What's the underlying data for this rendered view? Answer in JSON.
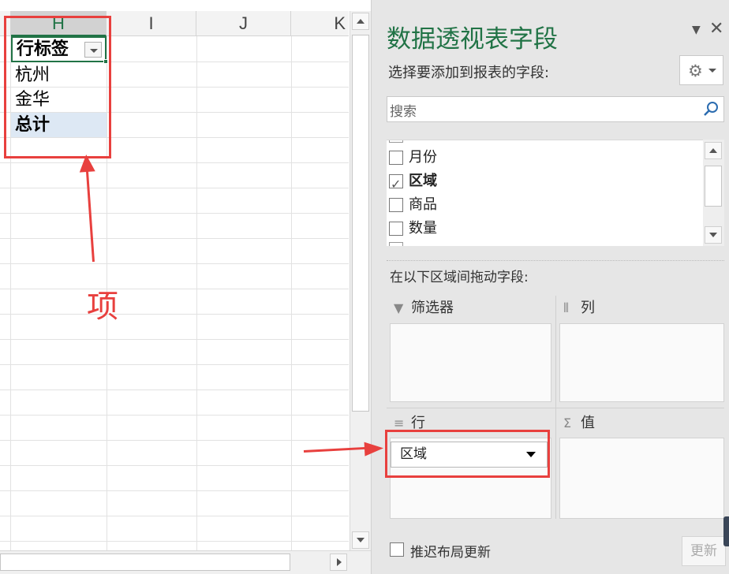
{
  "sheet": {
    "columns": [
      "H",
      "I",
      "J",
      "K"
    ],
    "active_column": "H",
    "pivot": {
      "header": "行标签",
      "rows": [
        "杭州",
        "金华"
      ],
      "total": "总计"
    }
  },
  "annotations": {
    "item_label": "项"
  },
  "panel": {
    "title": "数据透视表字段",
    "subtitle": "选择要添加到报表的字段:",
    "search_placeholder": "搜索",
    "fields": [
      {
        "label": "月份",
        "checked": false
      },
      {
        "label": "区域",
        "checked": true
      },
      {
        "label": "商品",
        "checked": false
      },
      {
        "label": "数量",
        "checked": false
      }
    ],
    "drag_prompt": "在以下区域间拖动字段:",
    "areas": {
      "filters": "筛选器",
      "columns": "列",
      "rows": "行",
      "values": "值"
    },
    "row_field": "区域",
    "defer_label": "推迟布局更新",
    "update_label": "更新"
  },
  "colors": {
    "accent": "#217346",
    "annotation": "#e8403e",
    "selection": "#dde8f4"
  }
}
